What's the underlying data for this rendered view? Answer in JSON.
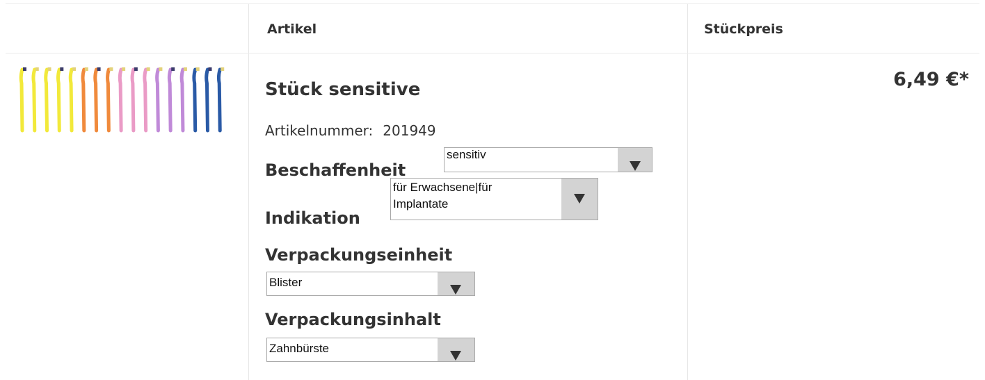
{
  "table": {
    "headers": {
      "article": "Artikel",
      "unit_price": "Stückpreis"
    }
  },
  "product": {
    "title": "Stück sensitive",
    "article_number_label": "Artikelnummer:",
    "article_number": "201949",
    "price": "6,49 €*",
    "image_icon": "toothbrushes-image"
  },
  "options": {
    "beschaffenheit": {
      "label": "Beschaffenheit",
      "value": "sensitiv"
    },
    "indikation": {
      "label": "Indikation",
      "value": "für Erwachsene|für Implantate"
    },
    "verpackungseinheit": {
      "label": "Verpackungseinheit",
      "value": "Blister"
    },
    "verpackungsinhalt": {
      "label": "Verpackungsinhalt",
      "value": "Zahnbürste"
    }
  },
  "colors": {
    "text": "#333333",
    "border": "#ebebeb",
    "select_button": "#d3d3d3",
    "brush_yellow": "#f2e93a",
    "brush_orange": "#f08a3c",
    "brush_pink": "#ea9bc6",
    "brush_purple": "#c08ad8",
    "brush_blue": "#2a5aa6"
  }
}
